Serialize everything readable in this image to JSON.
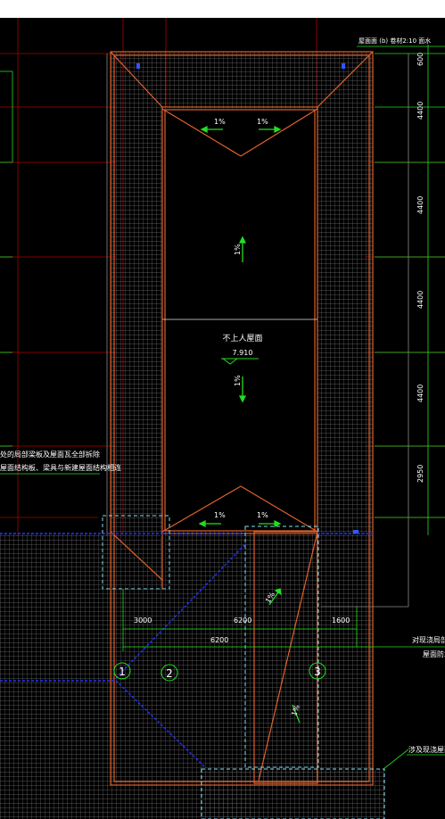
{
  "colors": {
    "background": "#000000",
    "grid_axis": "#cc0000",
    "hatch": "#7a7a7a",
    "roof_outline": "#e0622c",
    "green": "#22dd22",
    "blue": "#2233ff",
    "cyan": "#88ddee",
    "white_line": "#ffffff"
  },
  "header_notes": {
    "roof_legend": "屋面面 (b) 卷材2:10 面水"
  },
  "dimensions_right": [
    "600",
    "4400",
    "4400",
    "4400",
    "4400",
    "2950"
  ],
  "dimensions_bottom": {
    "seg1": "3000",
    "seg2": "6200",
    "seg3": "1600",
    "total": "6200"
  },
  "grid_bubbles": [
    "1",
    "2",
    "3"
  ],
  "slopes": {
    "top_left": "1%",
    "top_right": "1%",
    "upper_mid": "1%",
    "lower_mid": "1%",
    "bottom_left": "1%",
    "bottom_right": "1%",
    "lower_rect_top": "1%",
    "lower_rect_mid": "1%"
  },
  "center_label": "不上人屋面",
  "elevation": "7.910",
  "left_notes": [
    "处的局部梁板及屋面瓦全部拆除",
    "屋面结构板、梁具与新建屋面结构相连"
  ],
  "right_notes": [
    "对现浇局部结",
    "屋面防水"
  ],
  "bottom_right_note": "涉及现浇屋面"
}
